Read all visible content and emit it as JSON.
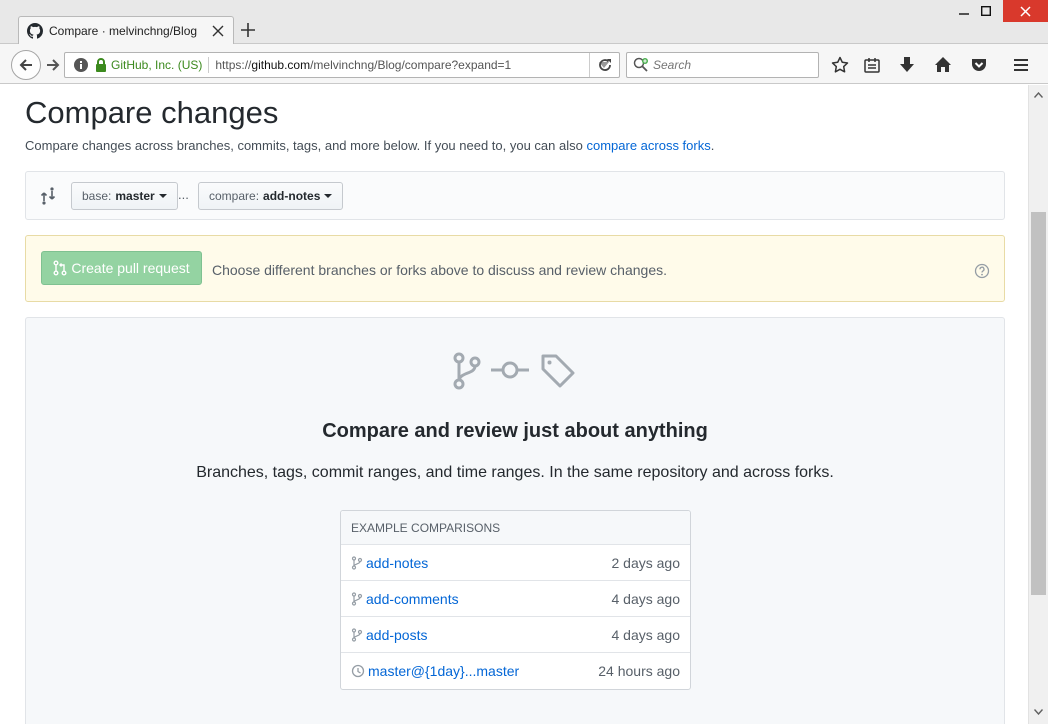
{
  "window": {
    "tab_title": "Compare · melvinchng/Blog"
  },
  "navbar": {
    "org_label": "GitHub, Inc. (US)",
    "url_prefix": "https://",
    "url_host": "github.com",
    "url_path": "/melvinchng/Blog/compare?expand=1",
    "search_placeholder": "Search"
  },
  "page": {
    "title": "Compare changes",
    "subtitle": "Compare changes across branches, commits, tags, and more below. If you need to, you can also ",
    "subtitle_link": "compare across forks",
    "subtitle_end": "."
  },
  "range": {
    "base_label": "base:",
    "base_value": "master",
    "dots": "...",
    "compare_label": "compare:",
    "compare_value": "add-notes"
  },
  "flash": {
    "button_label": "Create pull request",
    "message": "Choose different branches or forks above to discuss and review changes."
  },
  "blankslate": {
    "title": "Compare and review just about anything",
    "text": "Branches, tags, commit ranges, and time ranges. In the same repository and across forks."
  },
  "examples": {
    "header": "EXAMPLE COMPARISONS",
    "items": [
      {
        "name": "add-notes",
        "time": "2 days ago",
        "icon": "branch-icon"
      },
      {
        "name": "add-comments",
        "time": "4 days ago",
        "icon": "branch-icon"
      },
      {
        "name": "add-posts",
        "time": "4 days ago",
        "icon": "branch-icon"
      },
      {
        "name": "master@{1day}...master",
        "time": "24 hours ago",
        "icon": "history-icon"
      }
    ]
  },
  "colors": {
    "link": "#0366d6",
    "pr_button": "#94d3a2",
    "flash_bg": "#fffbea",
    "org_green": "#3c8a1e"
  }
}
